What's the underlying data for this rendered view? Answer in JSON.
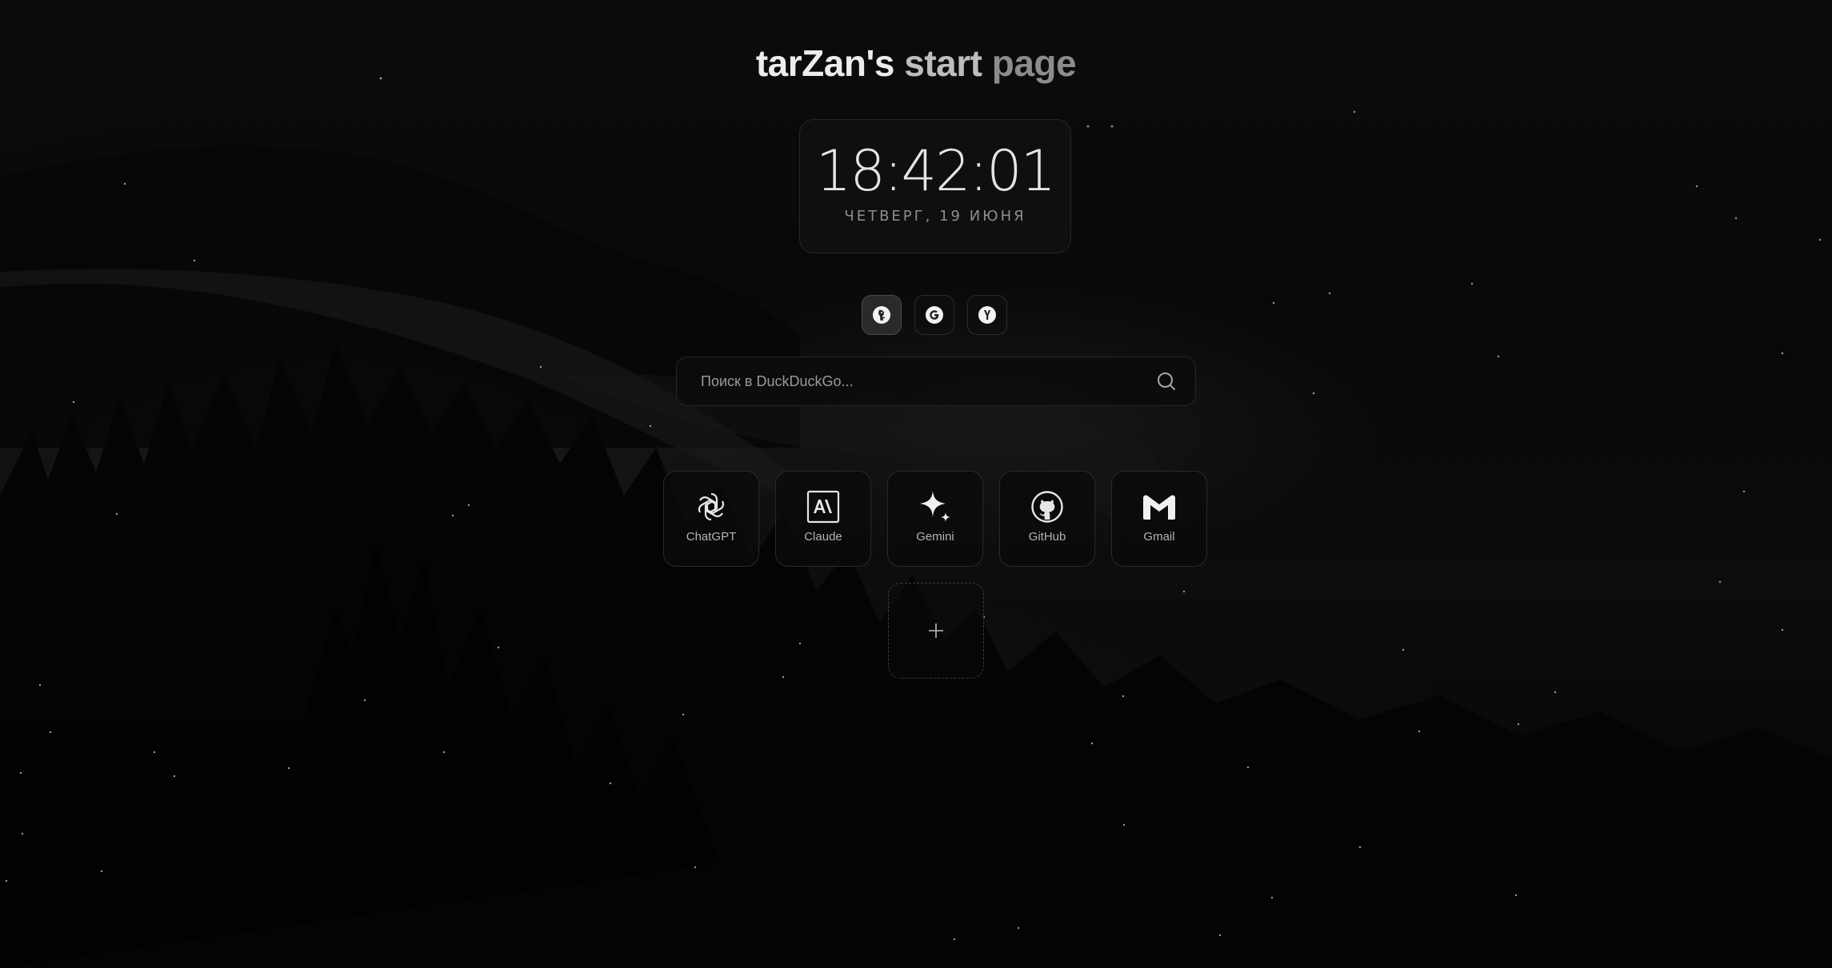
{
  "header": {
    "title_part1": "tarZan's",
    "title_part2": "start",
    "title_part3": "page"
  },
  "clock": {
    "time": "18:42:01",
    "date": "ЧЕТВЕРГ, 19 ИЮНЯ"
  },
  "search_engines": [
    {
      "name": "DuckDuckGo",
      "icon": "duckduckgo-icon",
      "active": true
    },
    {
      "name": "Google",
      "icon": "google-icon",
      "active": false
    },
    {
      "name": "Yandex",
      "icon": "yandex-icon",
      "active": false
    }
  ],
  "search": {
    "placeholder": "Поиск в DuckDuckGo...",
    "value": "",
    "icon": "search-icon"
  },
  "shortcuts": [
    {
      "label": "ChatGPT",
      "icon": "chatgpt-icon"
    },
    {
      "label": "Claude",
      "icon": "claude-icon"
    },
    {
      "label": "Gemini",
      "icon": "gemini-icon"
    },
    {
      "label": "GitHub",
      "icon": "github-icon"
    },
    {
      "label": "Gmail",
      "icon": "gmail-icon"
    }
  ],
  "add_shortcut": {
    "label": "+",
    "icon": "plus-icon"
  },
  "colors": {
    "background": "#050505",
    "title_bright": "#ececec",
    "title_mid": "#bdbdbd",
    "title_dim": "#8c8c8c",
    "panel_border": "#262626"
  }
}
